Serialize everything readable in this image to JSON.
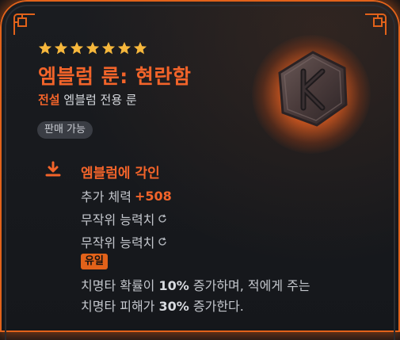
{
  "item": {
    "stars": 7,
    "title": "엠블럼 룬: 현란함",
    "grade": "전설",
    "type": "엠블럼 전용 룬",
    "tradable": "판매 가능",
    "rune_icon": "emblem-rune-icon"
  },
  "engrave": {
    "icon": "download-arrow-icon",
    "title": "엠블럼에 각인",
    "stat_label": "추가 체력",
    "stat_value": "+508",
    "random_1": "무작위 능력치",
    "random_2": "무작위 능력치",
    "unique_tag": "유일",
    "desc_1a": "치명타 확률이 ",
    "desc_1b": "10%",
    "desc_1c": " 증가하며, 적에게 주는",
    "desc_2a": "치명타 피해가 ",
    "desc_2b": "30%",
    "desc_2c": " 증가한다."
  },
  "colors": {
    "accent": "#f3642a",
    "frame": "#e2621a",
    "star": "#f6b73c",
    "badge_bg": "#3a3d44"
  }
}
